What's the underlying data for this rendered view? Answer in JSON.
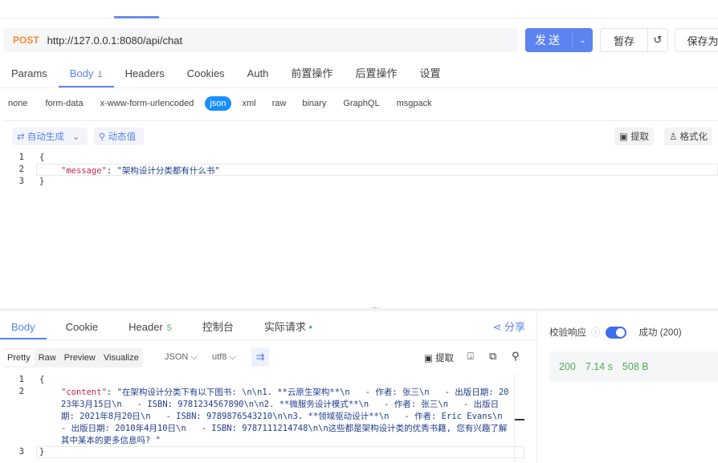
{
  "request": {
    "method": "POST",
    "url": "http://127.0.0.1:8080/api/chat",
    "send": "发送",
    "save_temp": "暂存",
    "save_as": "保存为"
  },
  "tabs": [
    {
      "label": "Params"
    },
    {
      "label": "Body",
      "badge": "1"
    },
    {
      "label": "Headers"
    },
    {
      "label": "Cookies"
    },
    {
      "label": "Auth"
    },
    {
      "label": "前置操作"
    },
    {
      "label": "后置操作"
    },
    {
      "label": "设置"
    }
  ],
  "body_types": [
    "none",
    "form-data",
    "x-www-form-urlencoded",
    "json",
    "xml",
    "raw",
    "binary",
    "GraphQL",
    "msgpack"
  ],
  "editor_toolbar": {
    "auto": "自动生成",
    "dynamic": "动态值",
    "extract": "提取",
    "format": "格式化"
  },
  "request_body": {
    "lines": [
      "1",
      "2",
      "3"
    ],
    "open": "{",
    "key": "\"message\"",
    "value": "\"架构设计分类都有什么书\"",
    "close": "}"
  },
  "response": {
    "tabs": [
      {
        "label": "Body"
      },
      {
        "label": "Cookie"
      },
      {
        "label": "Header",
        "badge": "5"
      },
      {
        "label": "控制台"
      },
      {
        "label": "实际请求"
      }
    ],
    "share": "分享",
    "views": [
      "Pretty",
      "Raw",
      "Preview",
      "Visualize"
    ],
    "format": "JSON",
    "encoding": "utf8",
    "extract": "提取",
    "lines": [
      "1",
      "2",
      "3"
    ],
    "key": "\"content\"",
    "value": "\"在架构设计分类下有以下图书: \\n\\n1. **云原生架构**\\n   - 作者: 张三\\n   - 出版日期: 2023年3月15日\\n   - ISBN: 9781234567890\\n\\n2. **微服务设计模式**\\n   - 作者: 张三\\n   - 出版日期: 2021年8月20日\\n   - ISBN: 9789876543210\\n\\n3. **领域驱动设计**\\n   - 作者: Eric Evans\\n   - 出版日期: 2010年4月10日\\n   - ISBN: 9787111214748\\n\\n这些都是架构设计类的优秀书籍, 您有兴趣了解其中某本的更多信息吗? \""
  },
  "validation": {
    "label": "校验响应",
    "result": "成功 (200)",
    "status": "200",
    "time": "7.14 s",
    "size": "508 B"
  }
}
